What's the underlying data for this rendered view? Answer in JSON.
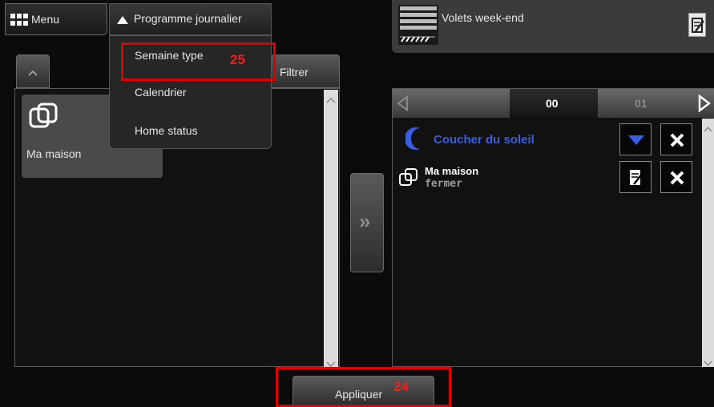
{
  "topbar": {
    "menu_label": "Menu",
    "dropdown_title": "Programme journalier"
  },
  "dropdown": {
    "items": [
      {
        "label": "Semaine type"
      },
      {
        "label": "Calendrier"
      },
      {
        "label": "Home status"
      }
    ],
    "annotation": "25"
  },
  "left_panel": {
    "filter_label": "Filtrer",
    "tile_label": "Ma maison"
  },
  "transfer_button": {
    "label": "»"
  },
  "scene": {
    "title": "Volets week-end"
  },
  "timeline": {
    "hours": [
      "00",
      "01"
    ]
  },
  "events": [
    {
      "title": "Coucher du soleil",
      "subtitle": ""
    },
    {
      "title": "Ma maison",
      "subtitle": "fermer"
    }
  ],
  "footer": {
    "apply_label": "Appliquer",
    "annotation": "24"
  },
  "colors": {
    "accent_blue": "#3a5ee0",
    "annotation_red": "#e00000"
  }
}
